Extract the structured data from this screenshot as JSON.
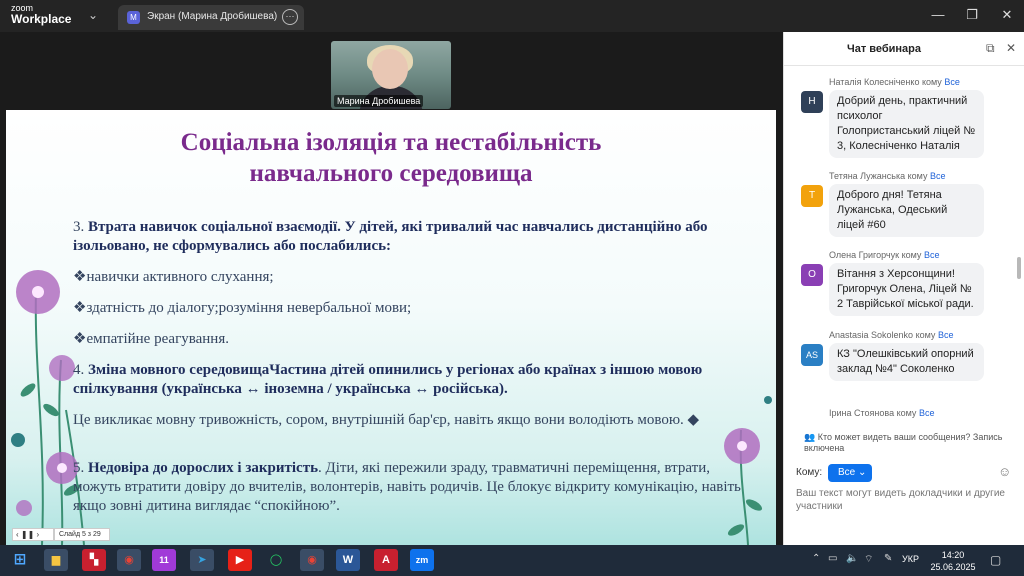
{
  "titlebar": {
    "logo_top": "zoom",
    "logo_bottom": "Workplace",
    "share_tab_badge": "M",
    "share_tab_label": "Экран (Марина Дробишева)"
  },
  "video": {
    "participant_name": "Марина Дробишева"
  },
  "slide": {
    "title_line1": "Соціальна ізоляція та нестабільність",
    "title_line2": "навчального середовища",
    "p3_num": "3. ",
    "p3_bold": "Втрата навичок соціальної взаємодії. У дітей, які тривалий час навчались дистанційно або ізольовано, не сформувались або послабились:",
    "bullet1": "навички активного слухання;",
    "bullet2": "здатність до діалогу;розуміння невербальної мови;",
    "bullet3": "емпатійне реагування.",
    "p4_num": "4. ",
    "p4_bold": "Зміна мовного середовищаЧастина дітей опинились у регіонах або країнах з іншою мовою спілкування (українська ↔ іноземна / українська ↔ російська).",
    "p4_plain": "Це викликає мовну тривожність, сором, внутрішній бар'єр, навіть якщо вони володіють мовою.",
    "p5_num": "5. ",
    "p5_bold": "Недовіра до дорослих і закритість",
    "p5_plain": ". Діти, які пережили зраду, травматичні переміщення, втрати, можуть втратити довіру до вчителів, волонтерів, навіть родичів. Це блокує відкриту комунікацію, навіть якщо зовні дитина виглядає “спокійною”.",
    "slide_counter": "Слайд 5 з 29"
  },
  "chat": {
    "title": "Чат вебинара",
    "to_word": "кому",
    "messages": [
      {
        "sender": "Наталія Колесніченко",
        "to": "Все",
        "initial": "Н",
        "color": "#2f4058",
        "text": "Добрий день, практичний психолог Голопристанський ліцей № 3, Колесніченко Наталія"
      },
      {
        "sender": "Тетяна Лужанська",
        "to": "Все",
        "initial": "Т",
        "color": "#f2a20c",
        "text": "Доброго дня! Тетяна Лужанська, Одеський ліцей #60"
      },
      {
        "sender": "Олена Григорчук",
        "to": "Все",
        "initial": "О",
        "color": "#8a3fb4",
        "text": "Вітання з Херсонщини! Григорчук Олена, Ліцей № 2 Таврійської міської ради."
      },
      {
        "sender": "Anastasia Sokolenko",
        "to": "Все",
        "initial": "AS",
        "color": "#2a7fc4",
        "text": "КЗ \"Олешківський опорний заклад №4\" Соколенко"
      },
      {
        "sender": "Ірина Стоянова",
        "to": "Все",
        "initial": "",
        "color": "#999999",
        "text": ""
      }
    ],
    "visibility_note": "Кто может видеть ваши сообщения? Запись включена",
    "to_label": "Кому:",
    "to_value": "Все",
    "input_placeholder": "Ваш текст могут видеть докладчики и другие участники"
  },
  "taskbar": {
    "badge_count": "11",
    "lang": "УКР",
    "time": "14:20",
    "date": "25.06.2025"
  }
}
